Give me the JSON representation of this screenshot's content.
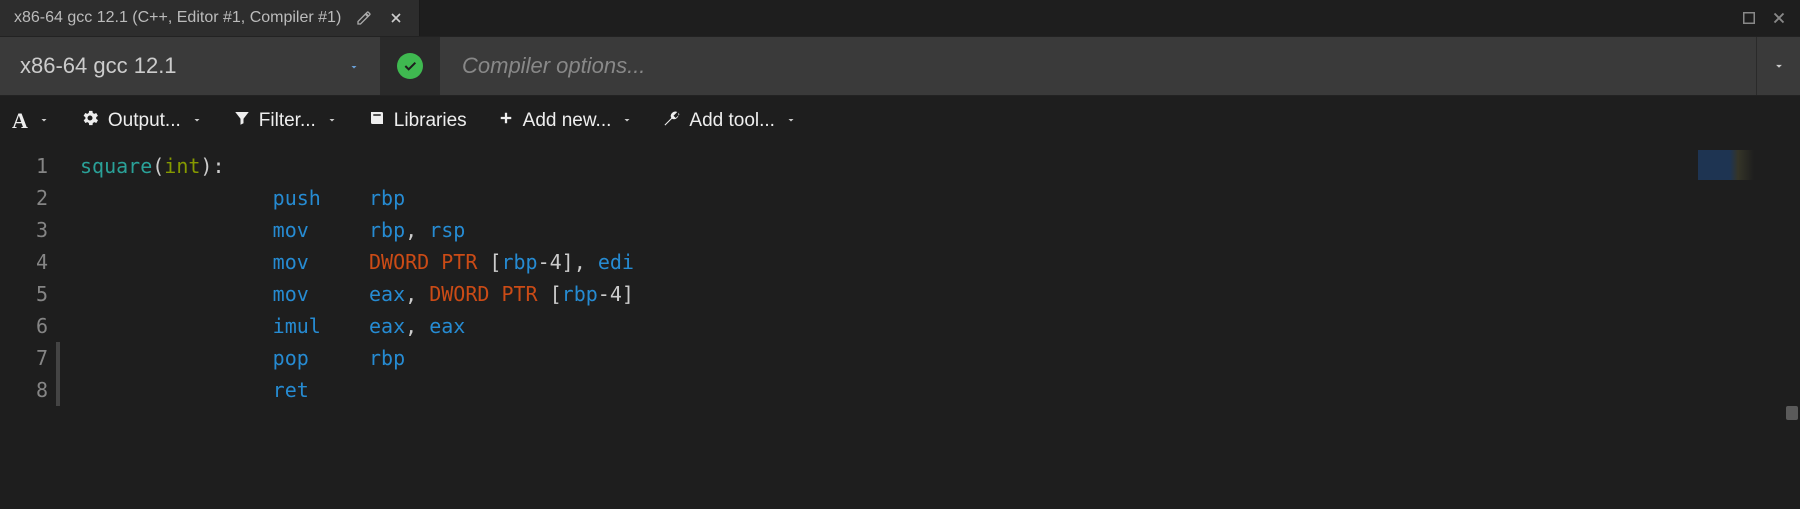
{
  "tab": {
    "title": "x86-64 gcc 12.1 (C++, Editor #1, Compiler #1)"
  },
  "compiler": {
    "selected": "x86-64 gcc 12.1",
    "options_placeholder": "Compiler options..."
  },
  "toolbar": {
    "font_label": "A",
    "output_label": "Output...",
    "filter_label": "Filter...",
    "libraries_label": "Libraries",
    "addnew_label": "Add new...",
    "addtool_label": "Add tool..."
  },
  "asm": {
    "lines": [
      {
        "n": 1,
        "tokens": [
          {
            "t": "square",
            "c": "label"
          },
          {
            "t": "(",
            "c": "punct"
          },
          {
            "t": "int",
            "c": "type"
          },
          {
            "t": ")",
            "c": "punct"
          },
          {
            "t": ":",
            "c": "punct"
          }
        ]
      },
      {
        "n": 2,
        "indent": 2,
        "tokens": [
          {
            "t": "push",
            "c": "mnemonic",
            "pad": 8
          },
          {
            "t": "rbp",
            "c": "reg"
          }
        ]
      },
      {
        "n": 3,
        "indent": 2,
        "tokens": [
          {
            "t": "mov",
            "c": "mnemonic",
            "pad": 8
          },
          {
            "t": "rbp",
            "c": "reg"
          },
          {
            "t": ", ",
            "c": "comma"
          },
          {
            "t": "rsp",
            "c": "reg"
          }
        ]
      },
      {
        "n": 4,
        "indent": 2,
        "tokens": [
          {
            "t": "mov",
            "c": "mnemonic",
            "pad": 8
          },
          {
            "t": "DWORD PTR ",
            "c": "ptr"
          },
          {
            "t": "[",
            "c": "bracket"
          },
          {
            "t": "rbp",
            "c": "reg"
          },
          {
            "t": "-",
            "c": "punct"
          },
          {
            "t": "4",
            "c": "num"
          },
          {
            "t": "]",
            "c": "bracket"
          },
          {
            "t": ", ",
            "c": "comma"
          },
          {
            "t": "edi",
            "c": "reg"
          }
        ]
      },
      {
        "n": 5,
        "indent": 2,
        "tokens": [
          {
            "t": "mov",
            "c": "mnemonic",
            "pad": 8
          },
          {
            "t": "eax",
            "c": "reg"
          },
          {
            "t": ", ",
            "c": "comma"
          },
          {
            "t": "DWORD PTR ",
            "c": "ptr"
          },
          {
            "t": "[",
            "c": "bracket"
          },
          {
            "t": "rbp",
            "c": "reg"
          },
          {
            "t": "-",
            "c": "punct"
          },
          {
            "t": "4",
            "c": "num"
          },
          {
            "t": "]",
            "c": "bracket"
          }
        ]
      },
      {
        "n": 6,
        "indent": 2,
        "tokens": [
          {
            "t": "imul",
            "c": "mnemonic",
            "pad": 8
          },
          {
            "t": "eax",
            "c": "reg"
          },
          {
            "t": ", ",
            "c": "comma"
          },
          {
            "t": "eax",
            "c": "reg"
          }
        ]
      },
      {
        "n": 7,
        "indent": 2,
        "tokens": [
          {
            "t": "pop",
            "c": "mnemonic",
            "pad": 8
          },
          {
            "t": "rbp",
            "c": "reg"
          }
        ],
        "active": true
      },
      {
        "n": 8,
        "indent": 2,
        "tokens": [
          {
            "t": "ret",
            "c": "mnemonic"
          }
        ],
        "active": true
      }
    ]
  }
}
